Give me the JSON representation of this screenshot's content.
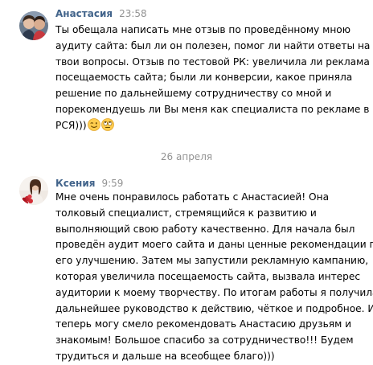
{
  "messages": [
    {
      "author": "Анастасия",
      "time": "23:58",
      "lines": [
        "Ты обещала написать мне отзыв по проведённому мною",
        "аудиту сайта: был ли он полезен, помог ли найти ответы на",
        "твои вопросы. Отзыв по тестовой РК: увеличила ли реклама",
        "посещаемость сайта; были ли конверсии, какое приняла",
        "решение по дальнейшему сотрудничеству со мной и",
        "порекомендуешь ли Вы меня как специалиста по рекламе в",
        "РСЯ)))"
      ],
      "emojis": [
        "winking-face-emoji",
        "rolling-eyes-face-emoji"
      ]
    },
    {
      "author": "Ксения",
      "time": "9:59",
      "lines": [
        "Мне очень понравилось работать с Анастасией! Она",
        "толковый специалист, стремящийся к развитию и",
        "выполняющий свою работу качественно. Для начала был",
        "проведён аудит моего сайта и даны ценные рекомендации по",
        "его улучшению. Затем мы запустили рекламную кампанию,",
        "которая увеличила посещаемость сайта, вызвала интерес",
        "аудитории к моему творчеству. По итогам работы я получила",
        "дальнейшее руководство к действию, чёткое и подробное. И",
        "теперь могу смело рекомендовать Анастасию друзьям и",
        "знакомым! Большое спасибо за сотрудничество!!! Будем",
        "трудиться и дальше на всеобщее благо)))"
      ]
    }
  ],
  "date_divider": "26 апреля",
  "colors": {
    "author": "#42648b",
    "time": "#939393",
    "text": "#000000",
    "background": "#ffffff"
  }
}
